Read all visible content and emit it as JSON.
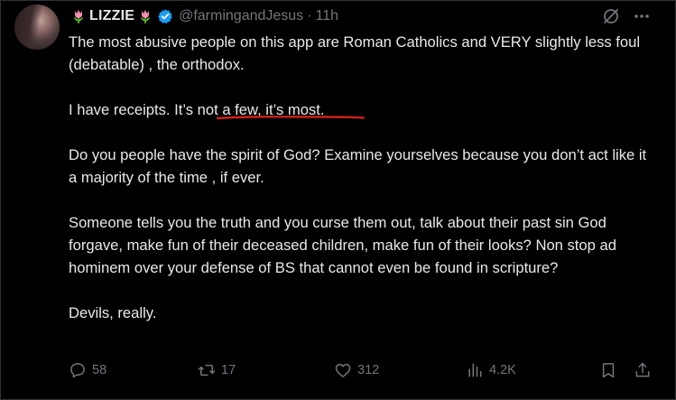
{
  "author": {
    "display_name": "LIZZIE",
    "handle": "@farmingandJesus",
    "separator": "·",
    "time": "11h"
  },
  "post": {
    "paragraphs": [
      "The most abusive people on this app are Roman Catholics and VERY slightly less foul (debatable) , the orthodox.",
      "I have receipts. It’s not a few, it’s most.",
      "Do you people have the spirit of God? Examine yourselves because you don’t act like it a majority of the time , if ever.",
      "Someone tells you the truth and you curse them out, talk about their past sin God forgave, make fun of their deceased children, make fun of their looks? Non stop ad hominem over your defense of BS that cannot even be found in scripture?",
      "Devils, really."
    ]
  },
  "actions": {
    "replies": "58",
    "reposts": "17",
    "likes": "312",
    "views": "4.2K"
  },
  "icons": {
    "tulip": "tulip-emoji",
    "verified": "verified-badge-icon",
    "grok": "grok-icon",
    "more": "more-options-icon",
    "reply": "reply-icon",
    "repost": "repost-icon",
    "like": "heart-icon",
    "views": "views-chart-icon",
    "bookmark": "bookmark-icon",
    "share": "share-icon"
  },
  "colors": {
    "background": "#000000",
    "text": "#e7e9ea",
    "muted": "#71767b",
    "verified": "#1d9bf0",
    "annotation": "#e0201a",
    "tulip_petal": "#f48fb1",
    "tulip_leaf": "#5fb336"
  }
}
